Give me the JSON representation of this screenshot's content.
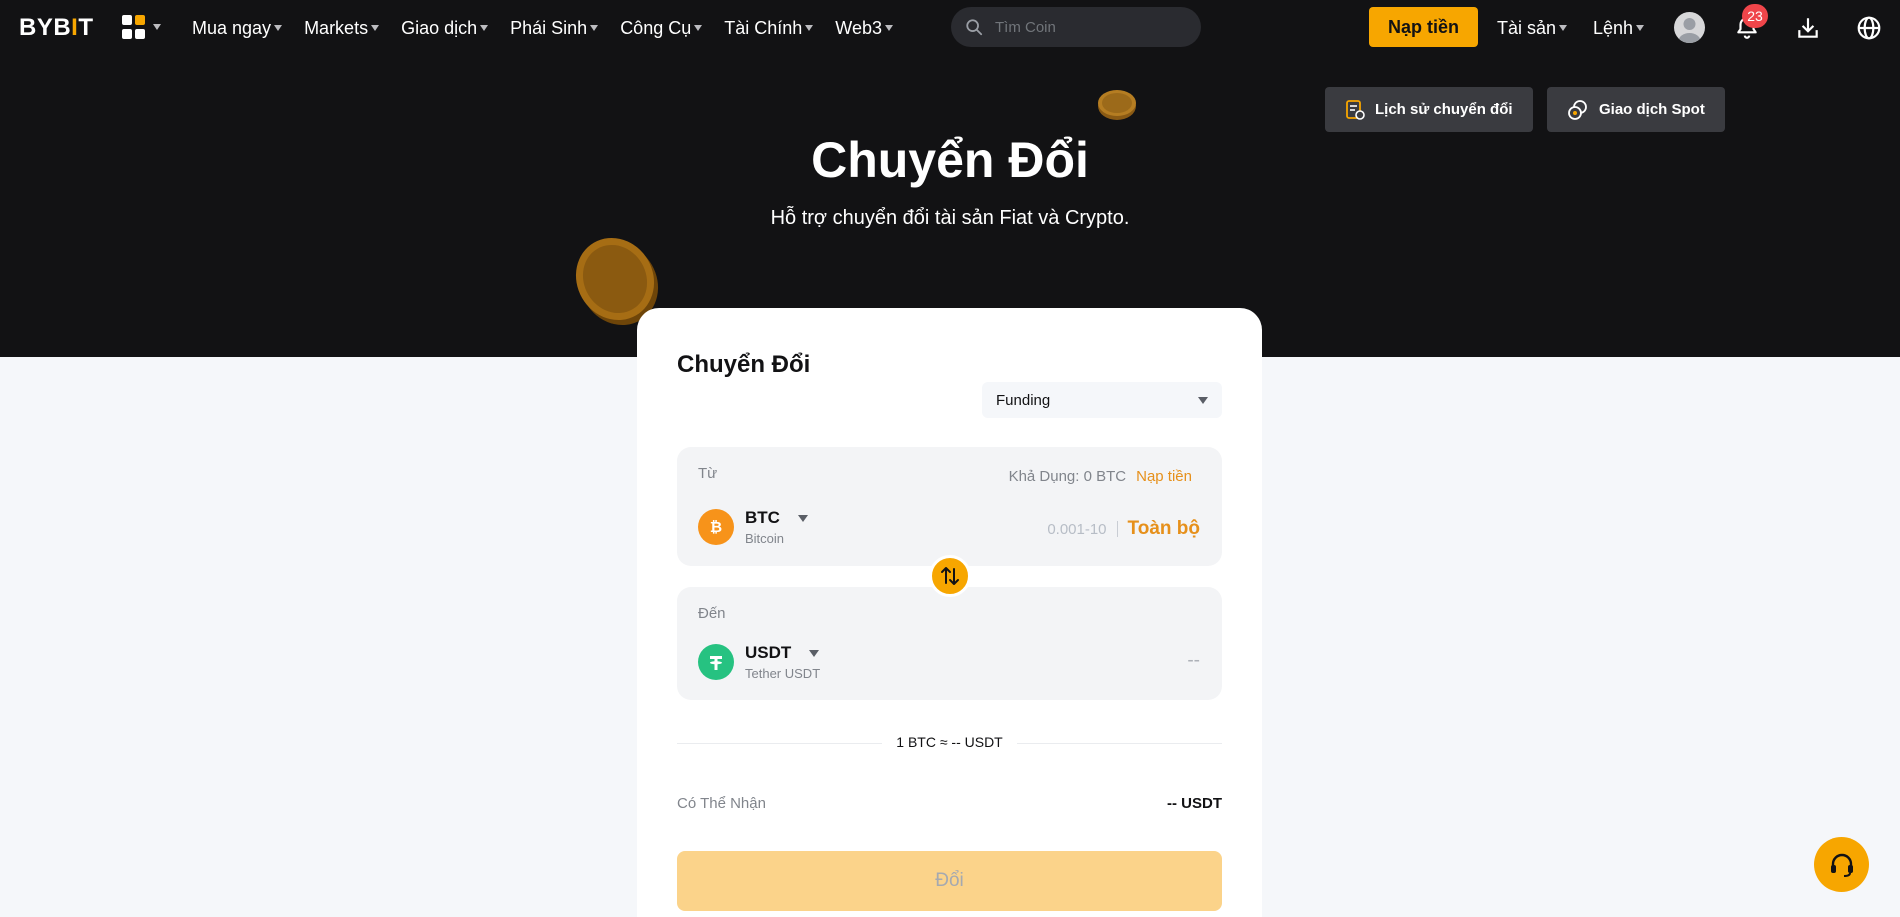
{
  "brand": {
    "logo_text": "BYB",
    "logo_bar": "I",
    "logo_end": "T",
    "accent": "#f7a600"
  },
  "nav": {
    "items": [
      {
        "label": "Mua ngay"
      },
      {
        "label": "Markets"
      },
      {
        "label": "Giao dịch"
      },
      {
        "label": "Phái Sinh"
      },
      {
        "label": "Công Cụ"
      },
      {
        "label": "Tài Chính"
      },
      {
        "label": "Web3"
      }
    ],
    "search_placeholder": "Tìm Coin",
    "deposit_label": "Nạp tiền",
    "assets_label": "Tài sản",
    "orders_label": "Lệnh",
    "notification_count": "23"
  },
  "hero": {
    "title": "Chuyển Đổi",
    "subtitle": "Hỗ trợ chuyển đổi tài sản Fiat và Crypto.",
    "history_button": "Lịch sử chuyển đổi",
    "spot_button": "Giao dịch Spot"
  },
  "convert": {
    "title": "Chuyển Đổi",
    "account": "Funding",
    "from": {
      "label": "Từ",
      "available_label": "Khả Dụng: 0 BTC",
      "deposit_link": "Nạp tiền",
      "symbol": "BTC",
      "name": "Bitcoin",
      "amount_placeholder": "0.001-10",
      "all_label": "Toàn bộ"
    },
    "to": {
      "label": "Đến",
      "symbol": "USDT",
      "name": "Tether USDT",
      "amount": "--"
    },
    "rate": "1 BTC ≈ -- USDT",
    "receive_label": "Có Thể Nhận",
    "receive_value": "-- USDT",
    "convert_button": "Đổi"
  }
}
